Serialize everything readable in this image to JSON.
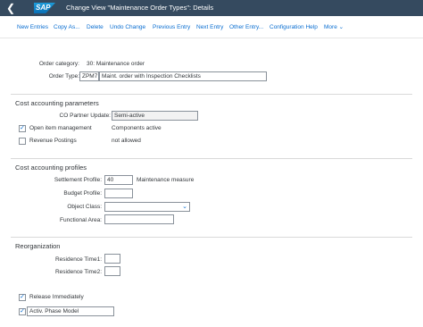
{
  "shell": {
    "back_icon": "back-arrow-icon",
    "logo_text": "SAP",
    "title": "Change View \"Maintenance Order Types\": Details"
  },
  "toolbar": {
    "new_entries": "New Entries",
    "copy_as": "Copy As...",
    "delete": "Delete",
    "undo_change": "Undo Change",
    "previous_entry": "Previous Entry",
    "next_entry": "Next Entry",
    "other_entry": "Other Entry...",
    "configuration_help": "Configuration Help",
    "more": "More"
  },
  "header": {
    "order_category_label": "Order category:",
    "order_category_value": "30: Maintenance order",
    "order_type_label": "Order Type:",
    "order_type_code": "ZPM7",
    "order_type_desc": "Maint. order with Inspection Checklists"
  },
  "cost_params": {
    "title": "Cost accounting parameters",
    "co_partner_label": "CO Partner Update:",
    "co_partner_value": "Semi-active",
    "open_item_label": "Open item management",
    "open_item_checked": true,
    "components_value": "Components active",
    "revenue_label": "Revenue Postings",
    "revenue_checked": false,
    "revenue_value": "not allowed"
  },
  "cost_profiles": {
    "title": "Cost accounting profiles",
    "settlement_label": "Settlement Profile:",
    "settlement_value": "40",
    "settlement_desc": "Maintenance measure",
    "budget_label": "Budget Profile:",
    "budget_value": "",
    "object_class_label": "Object Class:",
    "object_class_value": "",
    "functional_area_label": "Functional Area:",
    "functional_area_value": ""
  },
  "reorg": {
    "title": "Reorganization",
    "residence1_label": "Residence Time1:",
    "residence1_value": "",
    "residence2_label": "Residence Time2:",
    "residence2_value": "",
    "release_label": "Release Immediately",
    "release_checked": true,
    "activ_label": "Activ. Phase Model",
    "activ_checked": true
  }
}
